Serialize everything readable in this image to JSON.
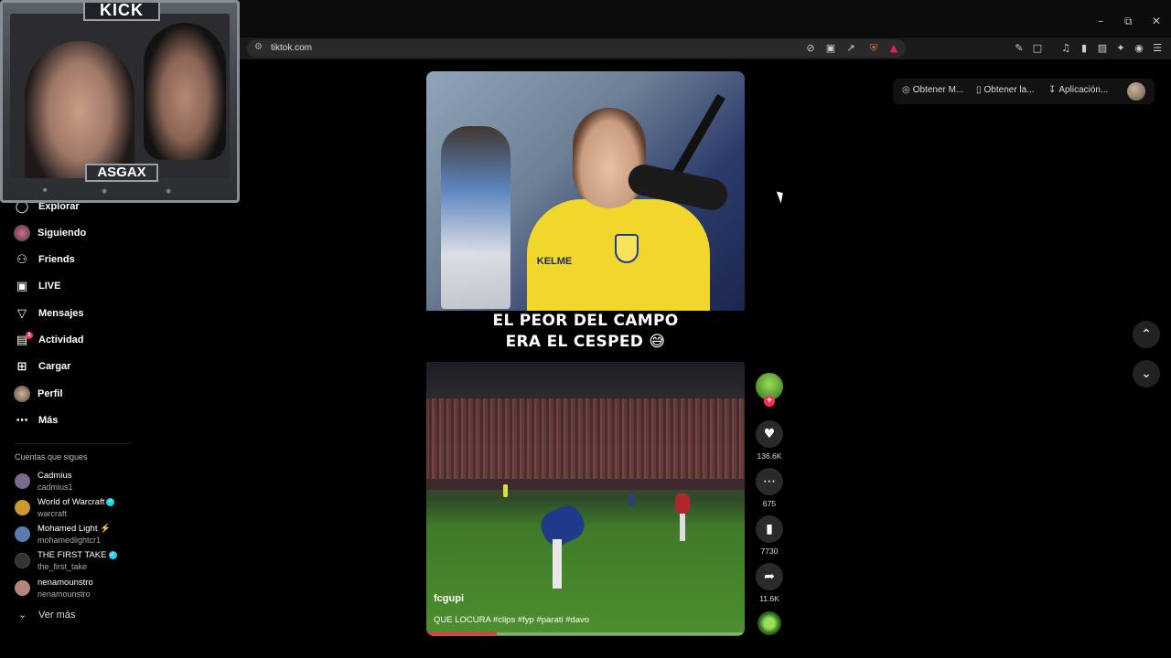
{
  "browser": {
    "url": "tiktok.com"
  },
  "window_controls": {
    "minimize": "–",
    "restore": "⧉",
    "close": "✕"
  },
  "topbar": {
    "get_coins": "Obtener M...",
    "get_app": "Obtener la...",
    "desktop_app": "Aplicación..."
  },
  "overlay": {
    "platform": "KICK",
    "streamer": "ASGAX"
  },
  "sidebar": {
    "items": [
      {
        "label": "Explorar",
        "icon": "compass-icon"
      },
      {
        "label": "Siguiendo",
        "icon": "avatar"
      },
      {
        "label": "Friends",
        "icon": "friends-icon"
      },
      {
        "label": "LIVE",
        "icon": "live-tv-icon"
      },
      {
        "label": "Mensajes",
        "icon": "send-icon"
      },
      {
        "label": "Actividad",
        "icon": "activity-icon",
        "badge": "1"
      },
      {
        "label": "Cargar",
        "icon": "upload-plus-icon"
      },
      {
        "label": "Perfil",
        "icon": "avatar"
      },
      {
        "label": "Más",
        "icon": "more-dots-icon"
      }
    ],
    "following_title": "Cuentas que sigues",
    "following": [
      {
        "name": "Cadmius",
        "handle": "cadmius1",
        "verified": false,
        "color": "#7b6a8a"
      },
      {
        "name": "World of Warcraft",
        "handle": "warcraft",
        "verified": true,
        "color": "#c89b2a"
      },
      {
        "name": "Mohamed Light ⚡",
        "handle": "mohamedlightcr1",
        "verified": false,
        "color": "#5a7bb0"
      },
      {
        "name": "THE FIRST TAKE",
        "handle": "the_first_take",
        "verified": true,
        "color": "#333333"
      },
      {
        "name": "nenamounstro",
        "handle": "nenamounstro",
        "verified": false,
        "color": "#b5857a"
      }
    ],
    "see_more": "Ver más"
  },
  "video": {
    "caption_line1": "EL PEOR DEL CAMPO",
    "caption_line2": "ERA EL CESPED 😅",
    "shirt_text": "KELME",
    "author": "fcgupi",
    "description": "QUE LOCURA #clips #fyp #parati #davo",
    "progress": 0.22
  },
  "actions": {
    "likes": "136.6K",
    "comments": "675",
    "saves": "7730",
    "shares": "11.6K"
  },
  "colors": {
    "accent": "#fe2c55",
    "verified": "#20d5ec"
  }
}
